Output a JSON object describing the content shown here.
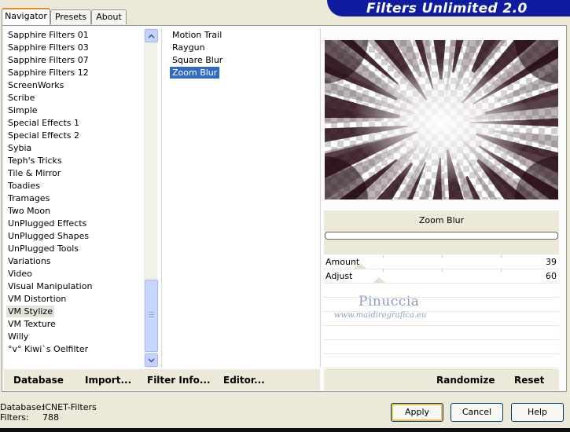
{
  "tabs": [
    {
      "label": "Navigator",
      "active": true
    },
    {
      "label": "Presets",
      "active": false
    },
    {
      "label": "About",
      "active": false
    }
  ],
  "banner": {
    "title": "Filters Unlimited 2.0"
  },
  "categories": {
    "items": [
      "Sapphire Filters 01",
      "Sapphire Filters 03",
      "Sapphire Filters 07",
      "Sapphire Filters 12",
      "ScreenWorks",
      "Scribe",
      "Simple",
      "Special Effects 1",
      "Special Effects 2",
      "Sybia",
      "Teph's Tricks",
      "Tile & Mirror",
      "Toadies",
      "Tramages",
      "Two Moon",
      "UnPlugged Effects",
      "UnPlugged Shapes",
      "UnPlugged Tools",
      "Variations",
      "Video",
      "Visual Manipulation",
      "VM Distortion",
      "VM Stylize",
      "VM Texture",
      "Willy",
      "°v° Kiwi`s Oelfilter"
    ],
    "selected": "VM Stylize"
  },
  "filters": {
    "items": [
      "Motion Trail",
      "Raygun",
      "Square Blur",
      "Zoom Blur"
    ],
    "selected": "Zoom Blur"
  },
  "preview": {
    "filter_name": "Zoom Blur"
  },
  "sliders": [
    {
      "label": "Amount",
      "value": "39"
    },
    {
      "label": "Adjust",
      "value": "60"
    }
  ],
  "watermark": {
    "name": "Pinuccia",
    "url": "www.maidiregrafica.eu"
  },
  "toolbar": {
    "database": "Database",
    "import": "Import...",
    "filter_info": "Filter Info...",
    "editor": "Editor...",
    "randomize": "Randomize",
    "reset": "Reset"
  },
  "status": {
    "database_label": "Database:",
    "database_value": "ICNET-Filters",
    "filters_label": "Filters:",
    "filters_value": "788"
  },
  "buttons": {
    "apply": "Apply",
    "cancel": "Cancel",
    "help": "Help"
  },
  "colors": {
    "accent": "#0f1ca0",
    "selection": "#316ac5",
    "tab_highlight": "#e68b2c"
  }
}
